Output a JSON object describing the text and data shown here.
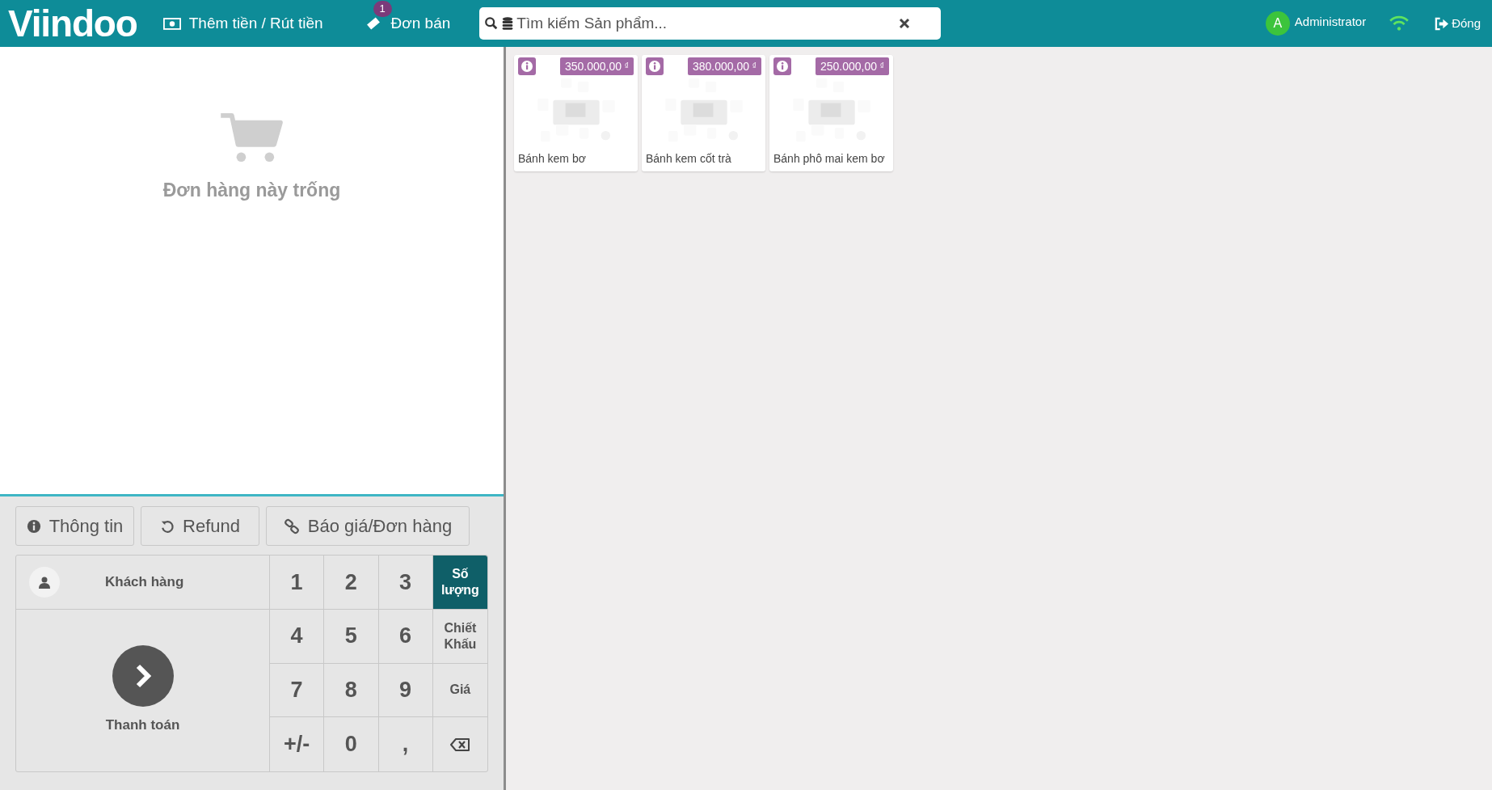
{
  "header": {
    "logo": "Viindoo",
    "cash_button": "Thêm tiền / Rút tiền",
    "orders_button": {
      "label": "Đơn bán",
      "count": "1"
    },
    "search": {
      "placeholder": "Tìm kiếm Sản phẩm..."
    },
    "user": {
      "initial": "A",
      "name": "Administrator"
    },
    "close_button": "Đóng"
  },
  "order": {
    "empty_message": "Đơn hàng này trống"
  },
  "actions": [
    {
      "kind": "info",
      "label": "Thông tin"
    },
    {
      "kind": "refund",
      "label": "Refund"
    },
    {
      "kind": "link",
      "label": "Báo giá/Đơn hàng"
    }
  ],
  "customer_button": "Khách hàng",
  "payment_button": "Thanh toán",
  "keys": [
    {
      "kind": "digit",
      "label": "1"
    },
    {
      "kind": "digit",
      "label": "2"
    },
    {
      "kind": "digit",
      "label": "3"
    },
    {
      "kind": "mode",
      "label": "Số lượng",
      "selected": true
    },
    {
      "kind": "digit",
      "label": "4"
    },
    {
      "kind": "digit",
      "label": "5"
    },
    {
      "kind": "digit",
      "label": "6"
    },
    {
      "kind": "mode",
      "label": "Chiết Khấu",
      "selected": false
    },
    {
      "kind": "digit",
      "label": "7"
    },
    {
      "kind": "digit",
      "label": "8"
    },
    {
      "kind": "digit",
      "label": "9"
    },
    {
      "kind": "mode",
      "label": "Giá",
      "selected": false
    },
    {
      "kind": "digit",
      "label": "+/-"
    },
    {
      "kind": "digit",
      "label": "0"
    },
    {
      "kind": "digit",
      "label": ","
    },
    {
      "kind": "backspace"
    }
  ],
  "products": [
    {
      "name": "Bánh kem bơ",
      "price": "350.000,00",
      "currency": "₫"
    },
    {
      "name": "Bánh kem cốt trà",
      "price": "380.000,00",
      "currency": "₫"
    },
    {
      "name": "Bánh phô mai kem bơ",
      "price": "250.000,00",
      "currency": "₫"
    }
  ]
}
